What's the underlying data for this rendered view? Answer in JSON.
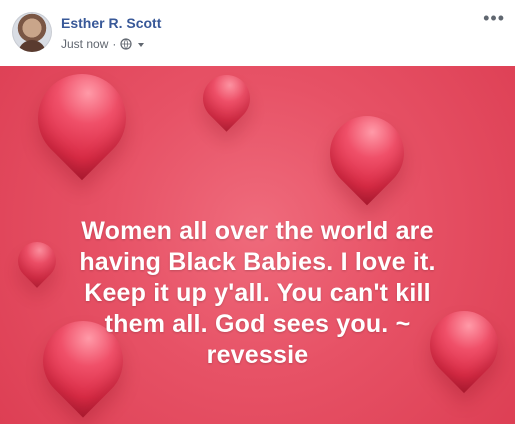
{
  "post": {
    "author": "Esther R. Scott",
    "timestamp": "Just now",
    "separator": "·",
    "audience_icon": "globe-icon",
    "dropdown_icon": "chevron-down-icon",
    "more_icon": "more-options-icon",
    "more_label": "•••"
  },
  "image": {
    "background_color": "#e75266",
    "heart_color": "#d92b45",
    "quote_lines": [
      "Women all over the world are",
      "having Black Babies. I love it.",
      "Keep it up y'all. You can't kill",
      "them all. God sees you. ~",
      "revessie"
    ]
  }
}
